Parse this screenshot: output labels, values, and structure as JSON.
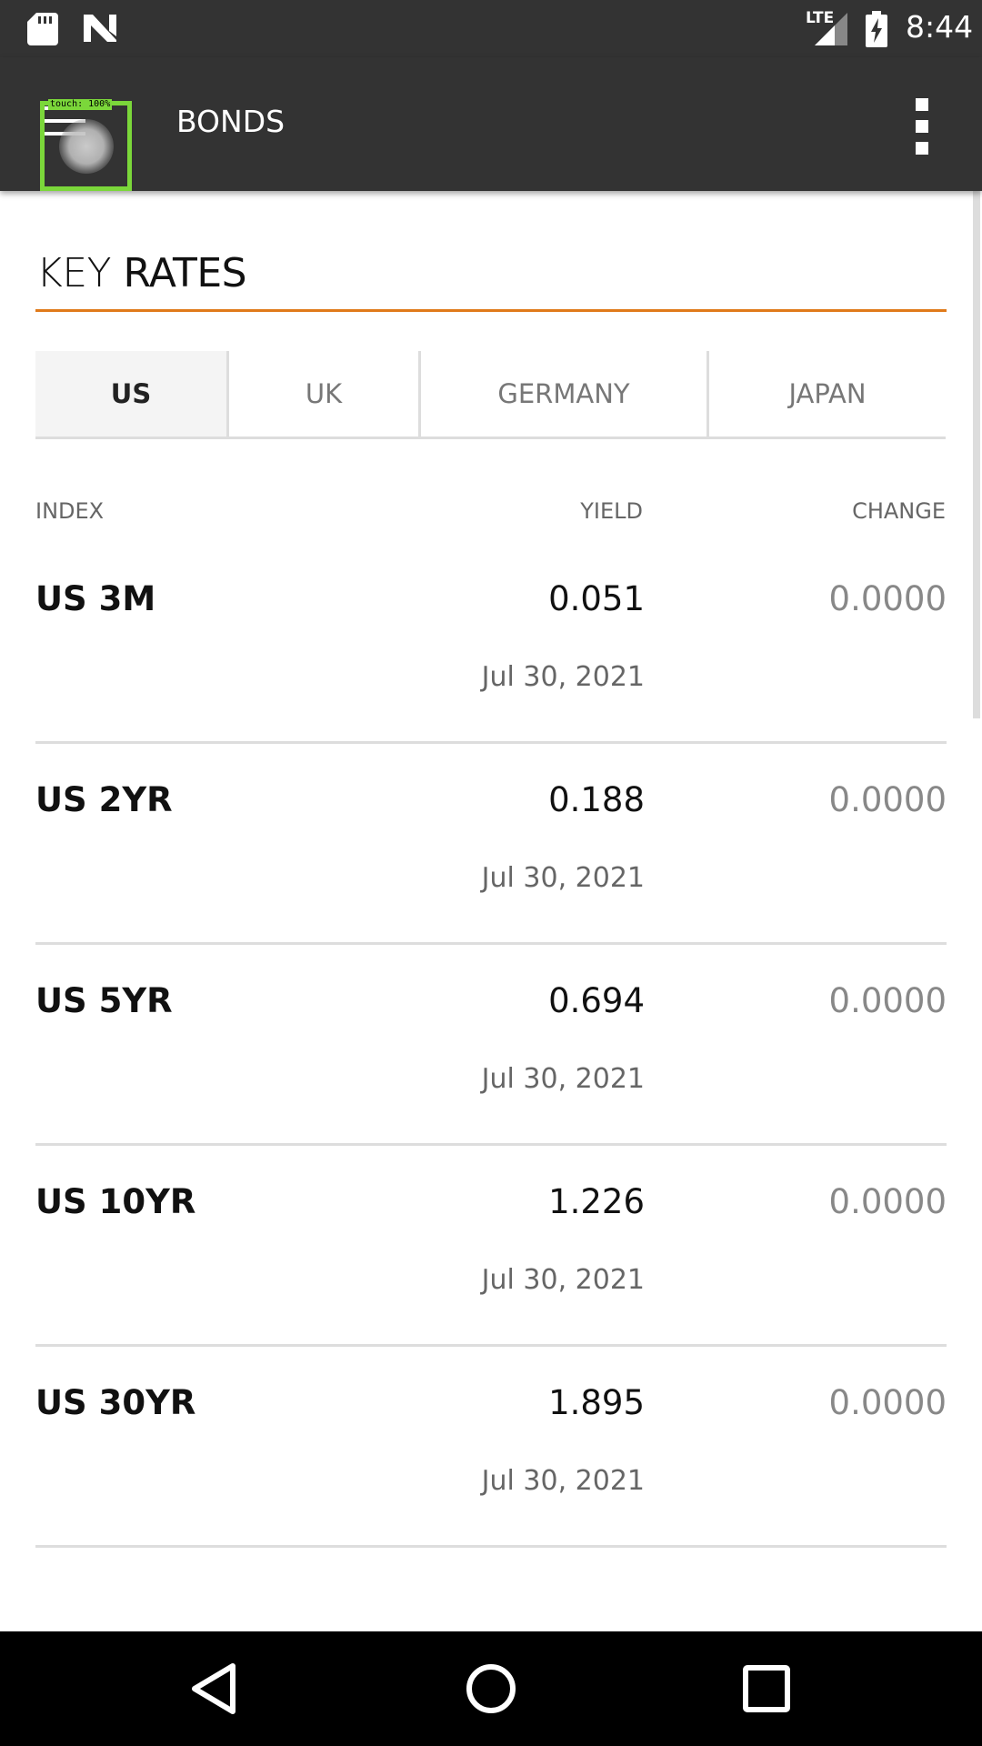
{
  "status_bar": {
    "network_label": "LTE",
    "time": "8:44",
    "icons": [
      "sd-card-icon",
      "n-icon",
      "signal-icon",
      "battery-charging-icon"
    ]
  },
  "app_bar": {
    "title": "BONDS",
    "menu_icon": "hamburger-icon",
    "overflow_icon": "more-vert-icon",
    "touch_overlay_label": "touch: 100%"
  },
  "section": {
    "title_light": "KEY",
    "title_bold": "RATES",
    "accent_color": "#e07a1a"
  },
  "tabs": [
    {
      "label": "US",
      "active": true
    },
    {
      "label": "UK",
      "active": false
    },
    {
      "label": "GERMANY",
      "active": false
    },
    {
      "label": "JAPAN",
      "active": false
    }
  ],
  "table": {
    "headers": {
      "index": "INDEX",
      "yield": "YIELD",
      "change": "CHANGE"
    },
    "rows": [
      {
        "name": "US 3M",
        "yield": "0.051",
        "change": "0.0000",
        "date": "Jul 30, 2021"
      },
      {
        "name": "US 2YR",
        "yield": "0.188",
        "change": "0.0000",
        "date": "Jul 30, 2021"
      },
      {
        "name": "US 5YR",
        "yield": "0.694",
        "change": "0.0000",
        "date": "Jul 30, 2021"
      },
      {
        "name": "US 10YR",
        "yield": "1.226",
        "change": "0.0000",
        "date": "Jul 30, 2021"
      },
      {
        "name": "US 30YR",
        "yield": "1.895",
        "change": "0.0000",
        "date": "Jul 30, 2021"
      }
    ]
  },
  "nav_bar": {
    "icons": [
      "back-icon",
      "home-icon",
      "recents-icon"
    ]
  }
}
